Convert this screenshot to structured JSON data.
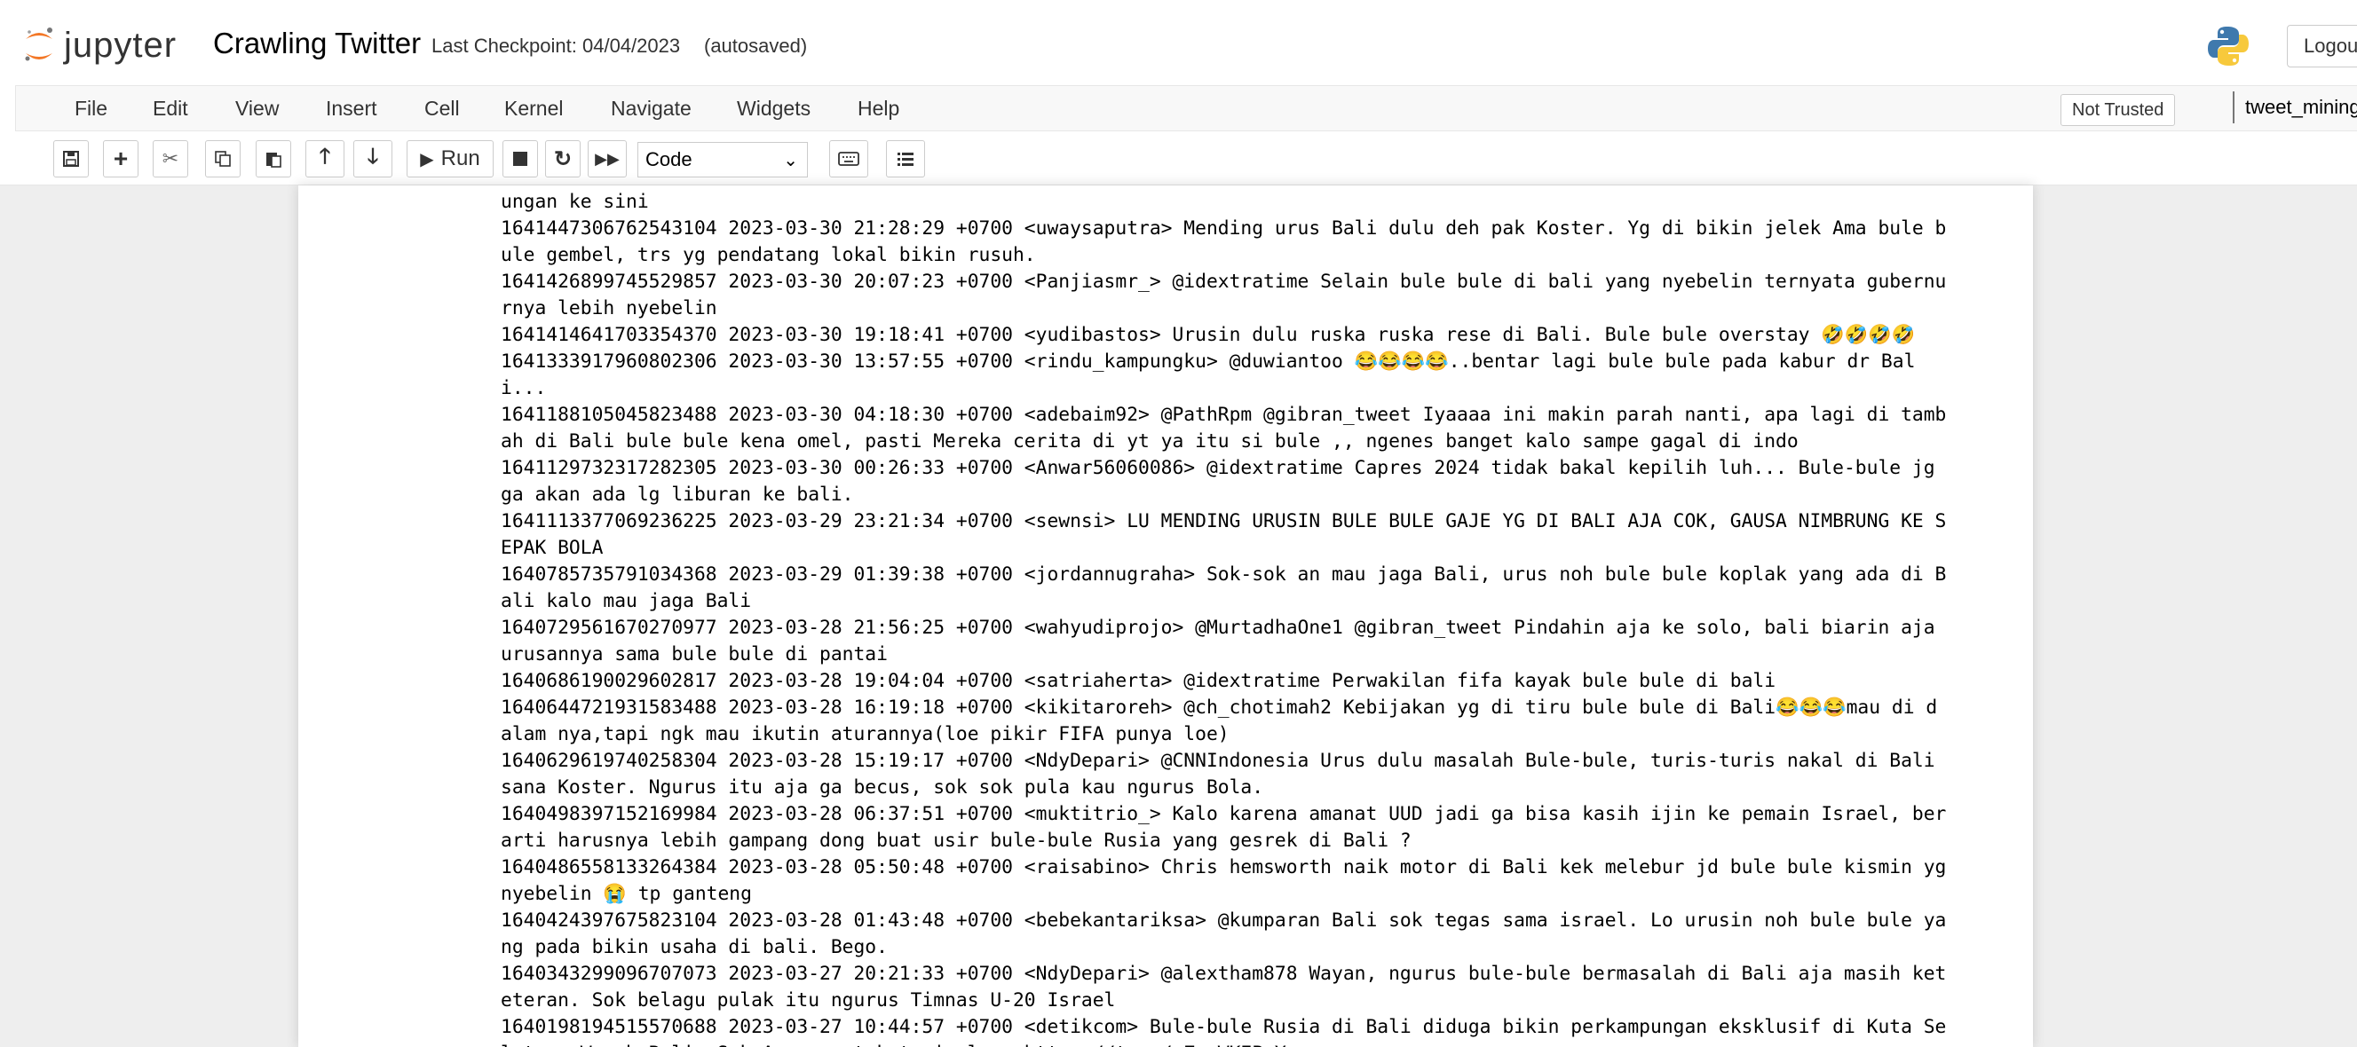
{
  "header": {
    "logo_text": "jupyter",
    "notebook_name": "Crawling Twitter",
    "checkpoint": "Last Checkpoint: 04/04/2023",
    "autosave": "(autosaved)",
    "logout": "Logou",
    "not_trusted": "Not Trusted",
    "kernel": "tweet_mining"
  },
  "menu": [
    "File",
    "Edit",
    "View",
    "Insert",
    "Cell",
    "Kernel",
    "Navigate",
    "Widgets",
    "Help"
  ],
  "toolbar": {
    "run_label": "Run",
    "cell_type": "Code"
  },
  "output_lines": [
    "ungan ke sini",
    "1641447306762543104 2023-03-30 21:28:29 +0700 <uwaysaputra> Mending urus Bali dulu deh pak Koster. Yg di bikin jelek Ama bule b",
    "ule gembel, trs yg pendatang lokal bikin rusuh.",
    "1641426899745529857 2023-03-30 20:07:23 +0700 <Panjiasmr_> @idextratime Selain bule bule di bali yang nyebelin ternyata gubernu",
    "rnya lebih nyebelin",
    "1641414641703354370 2023-03-30 19:18:41 +0700 <yudibastos> Urusin dulu ruska ruska rese di Bali. Bule bule overstay 🤣🤣🤣🤣",
    "1641333917960802306 2023-03-30 13:57:55 +0700 <rindu_kampungku> @duwiantoo 😂😂😂😂..bentar lagi bule bule pada kabur dr Bal",
    "i...",
    "1641188105045823488 2023-03-30 04:18:30 +0700 <adebaim92> @PathRpm @gibran_tweet Iyaaaa ini makin parah nanti, apa lagi di tamb",
    "ah di Bali bule bule kena omel, pasti Mereka cerita di yt ya itu si bule ,, ngenes banget kalo sampe gagal di indo",
    "1641129732317282305 2023-03-30 00:26:33 +0700 <Anwar56060086> @idextratime Capres 2024 tidak bakal kepilih luh... Bule-bule jg",
    "ga akan ada lg liburan ke bali.",
    "1641113377069236225 2023-03-29 23:21:34 +0700 <sewnsi> LU MENDING URUSIN BULE BULE GAJE YG DI BALI AJA COK, GAUSA NIMBRUNG KE S",
    "EPAK BOLA",
    "1640785735791034368 2023-03-29 01:39:38 +0700 <jordannugraha> Sok-sok an mau jaga Bali, urus noh bule bule koplak yang ada di B",
    "ali kalo mau jaga Bali",
    "1640729561670270977 2023-03-28 21:56:25 +0700 <wahyudiprojo> @MurtadhaOne1 @gibran_tweet Pindahin aja ke solo, bali biarin aja",
    "urusannya sama bule bule di pantai",
    "1640686190029602817 2023-03-28 19:04:04 +0700 <satriaherta> @idextratime Perwakilan fifa kayak bule bule di bali",
    "1640644721931583488 2023-03-28 16:19:18 +0700 <kikitaroreh> @ch_chotimah2 Kebijakan yg di tiru bule bule di Bali😂😂😂mau di d",
    "alam nya,tapi ngk mau ikutin aturannya(loe pikir FIFA punya loe)",
    "1640629619740258304 2023-03-28 15:19:17 +0700 <NdyDepari> @CNNIndonesia Urus dulu masalah Bule-bule, turis-turis nakal di Bali",
    "sana Koster. Ngurus itu aja ga becus, sok sok pula kau ngurus Bola.",
    "1640498397152169984 2023-03-28 06:37:51 +0700 <muktitrio_> Kalo karena amanat UUD jadi ga bisa kasih ijin ke pemain Israel, ber",
    "arti harusnya lebih gampang dong buat usir bule-bule Rusia yang gesrek di Bali ?",
    "1640486558133264384 2023-03-28 05:50:48 +0700 <raisabino> Chris hemsworth naik motor di Bali kek melebur jd bule bule kismin yg",
    "nyebelin 😭 tp ganteng",
    "1640424397675823104 2023-03-28 01:43:48 +0700 <bebekantariksa> @kumparan Bali sok tegas sama israel. Lo urusin noh bule bule ya",
    "ng pada bikin usaha di bali. Bego.",
    "1640343299096707073 2023-03-27 20:21:33 +0700 <NdyDepari> @alextham878 Wayan, ngurus bule-bule bermasalah di Bali aja masih ket",
    "eteran. Sok belagu pulak itu ngurus Timnas U-20 Israel",
    "1640198194515570688 2023-03-27 10:44:57 +0700 <detikcom> Bule-bule Rusia di Bali diduga bikin perkampungan eksklusif di Kuta Se",
    "latan. Warub Bali: Sok Aza mau tak tanimal... https://t.co/mZnuWKEPaY"
  ]
}
